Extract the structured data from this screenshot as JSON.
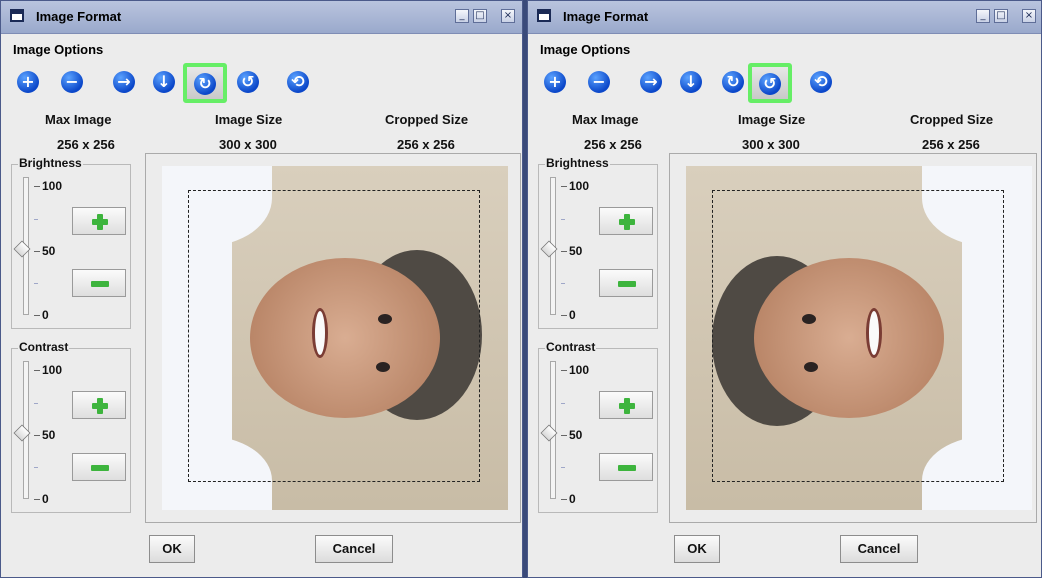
{
  "windows": [
    {
      "title": "Image Format",
      "menu": "Image Options",
      "toolbar": {
        "icons": [
          "zoom-in-icon",
          "zoom-out-icon",
          "arrow-right-icon",
          "arrow-down-icon",
          "rotate-clockwise-icon",
          "rotate-counterclockwise-icon",
          "refresh-icon"
        ],
        "selected": "rotate-clockwise-icon"
      },
      "headers": {
        "max": "Max Image",
        "size": "Image Size",
        "cropped": "Cropped Size"
      },
      "values": {
        "max": "256 x 256",
        "size": "300 x 300",
        "cropped": "256 x 256"
      },
      "brightness": {
        "title": "Brightness",
        "labels": [
          "100",
          "50",
          "0"
        ],
        "value": 50
      },
      "contrast": {
        "title": "Contrast",
        "labels": [
          "100",
          "50",
          "0"
        ],
        "value": 50
      },
      "buttons": {
        "ok": "OK",
        "cancel": "Cancel"
      }
    },
    {
      "title": "Image Format",
      "menu": "Image Options",
      "toolbar": {
        "icons": [
          "zoom-in-icon",
          "zoom-out-icon",
          "arrow-right-icon",
          "arrow-down-icon",
          "rotate-clockwise-icon",
          "rotate-counterclockwise-icon",
          "refresh-icon"
        ],
        "selected": "rotate-counterclockwise-icon"
      },
      "headers": {
        "max": "Max Image",
        "size": "Image Size",
        "cropped": "Cropped Size"
      },
      "values": {
        "max": "256 x 256",
        "size": "300 x 300",
        "cropped": "256 x 256"
      },
      "brightness": {
        "title": "Brightness",
        "labels": [
          "100",
          "50",
          "0"
        ],
        "value": 50
      },
      "contrast": {
        "title": "Contrast",
        "labels": [
          "100",
          "50",
          "0"
        ],
        "value": 50
      },
      "buttons": {
        "ok": "OK",
        "cancel": "Cancel"
      }
    }
  ],
  "colors": {
    "title_bar": "#a8b5d6",
    "selected_tool_border": "#66ee66",
    "tool_icon": "#0b47c9",
    "slider_button_icon": "#3db43d"
  }
}
